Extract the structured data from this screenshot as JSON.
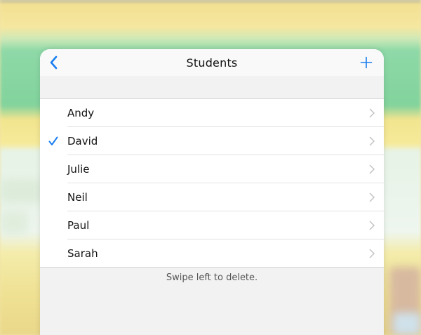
{
  "navbar": {
    "title": "Students",
    "back_icon": "chevron-left-icon",
    "add_icon": "plus-icon",
    "accent_color": "#1a7ef0"
  },
  "students": [
    {
      "name": "Andy",
      "selected": false
    },
    {
      "name": "David",
      "selected": true
    },
    {
      "name": "Julie",
      "selected": false
    },
    {
      "name": "Neil",
      "selected": false
    },
    {
      "name": "Paul",
      "selected": false
    },
    {
      "name": "Sarah",
      "selected": false
    }
  ],
  "footer": {
    "hint": "Swipe left to delete."
  }
}
